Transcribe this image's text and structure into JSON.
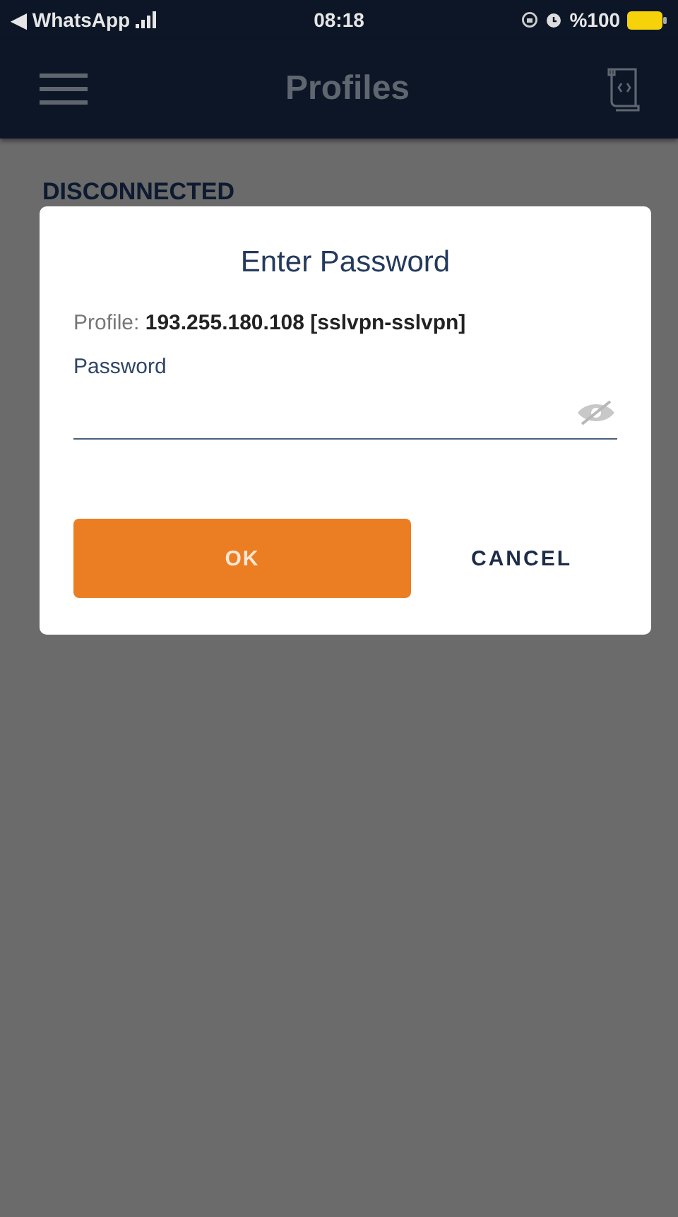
{
  "status_bar": {
    "back_app": "◀ WhatsApp",
    "time": "08:18",
    "battery": "%100"
  },
  "app_bar": {
    "title": "Profiles"
  },
  "status": "DISCONNECTED",
  "dialog": {
    "title": "Enter Password",
    "profile_label": "Profile:",
    "profile_value": "193.255.180.108 [sslvpn-sslvpn]",
    "field_label": "Password",
    "buttons": [
      {
        "label": "OK",
        "kind": "primary"
      },
      {
        "label": "CANCEL",
        "kind": "text"
      }
    ]
  }
}
